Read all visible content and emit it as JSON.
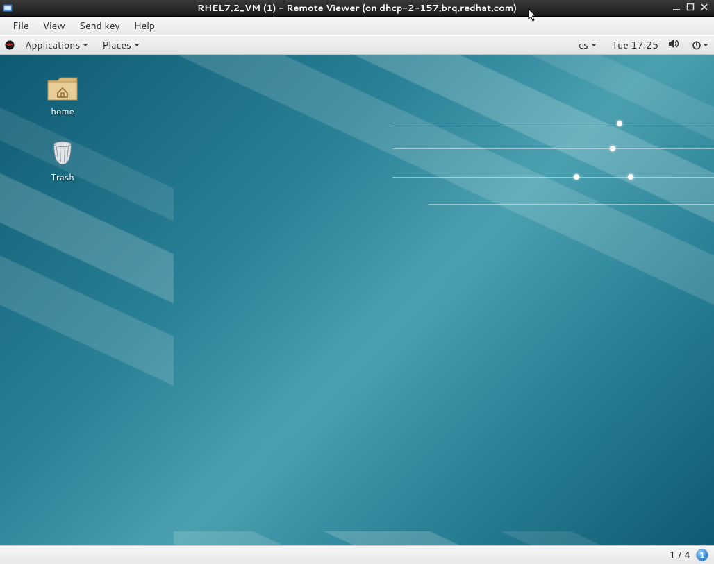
{
  "window": {
    "title": "RHEL7.2_VM (1) - Remote Viewer (on dhcp-2-157.brq.redhat.com)"
  },
  "menubar": {
    "items": [
      "File",
      "View",
      "Send key",
      "Help"
    ]
  },
  "panel": {
    "applications_label": "Applications",
    "places_label": "Places",
    "keyboard_layout": "cs",
    "clock": "Tue 17:25"
  },
  "desktop": {
    "icons": [
      {
        "name": "home",
        "label": "home",
        "kind": "folder"
      },
      {
        "name": "trash",
        "label": "Trash",
        "kind": "trash"
      }
    ]
  },
  "footer": {
    "workspaces": "1 / 4",
    "current_workspace": "1"
  }
}
